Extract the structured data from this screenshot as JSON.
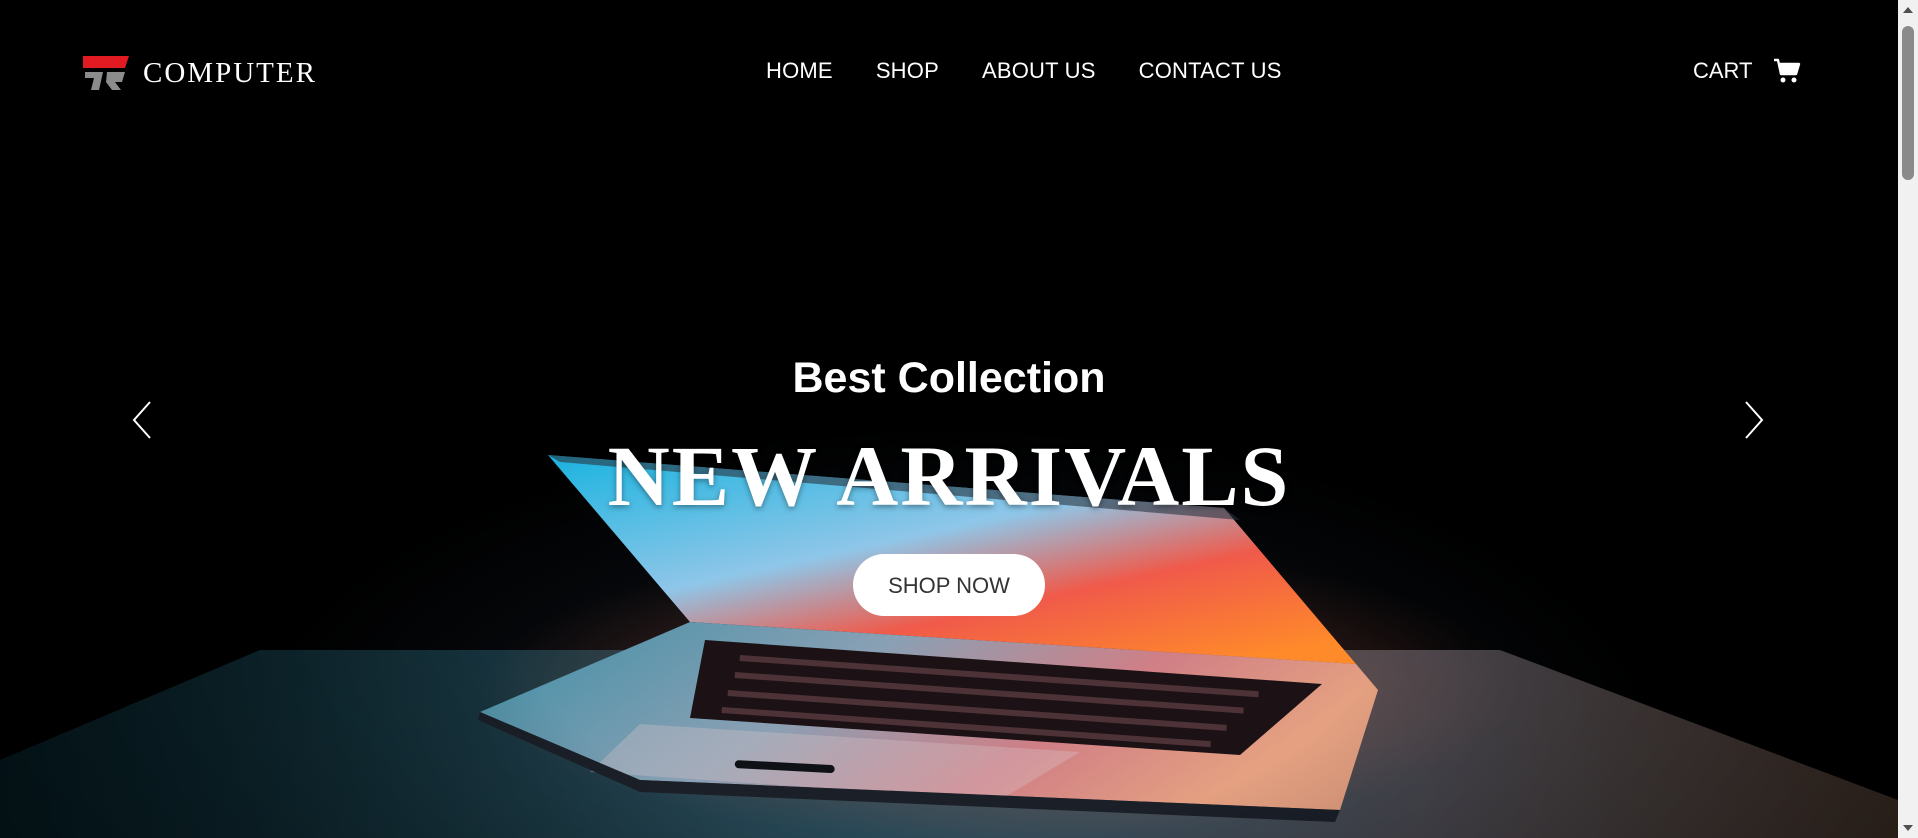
{
  "brand": {
    "name": "COMPUTER",
    "accent": "#e21b23",
    "mark_gray": "#9a9a9a"
  },
  "nav": [
    {
      "label": "HOME"
    },
    {
      "label": "SHOP"
    },
    {
      "label": "ABOUT US"
    },
    {
      "label": "CONTACT US"
    }
  ],
  "cart": {
    "label": "CART",
    "icon": "shopping-cart-icon"
  },
  "hero": {
    "subtitle": "Best Collection",
    "title": "NEW ARRIVALS",
    "cta_label": "SHOP NOW",
    "prev_icon": "chevron-left-icon",
    "next_icon": "chevron-right-icon"
  },
  "colors": {
    "background": "#000000",
    "text": "#ffffff",
    "button_bg": "#ffffff",
    "button_text": "#333333"
  }
}
